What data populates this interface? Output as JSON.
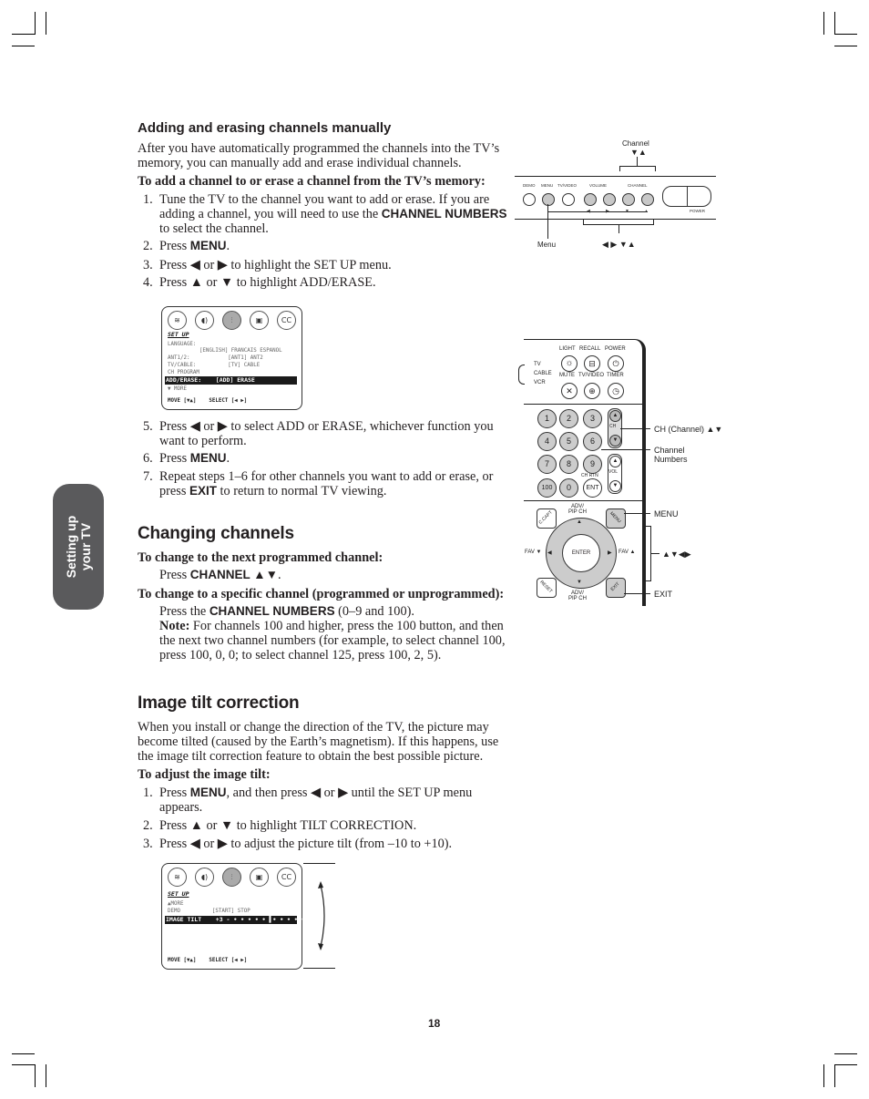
{
  "page": {
    "number": "18"
  },
  "side_tab": {
    "line1": "Setting up",
    "line2": "your TV"
  },
  "section1": {
    "title": "Adding and erasing channels manually",
    "intro": "After you have automatically programmed the channels into the TV’s memory, you can manually add and erase individual channels.",
    "subhead": "To add a channel to or erase a channel from the TV’s memory:",
    "steps": [
      {
        "n": "1.",
        "pre": "Tune the TV to the channel you want to add or erase. If you are adding a channel, you will need to use the ",
        "kw": "CHANNEL NUMBERS",
        "post": " to select the channel."
      },
      {
        "n": "2.",
        "pre": "Press ",
        "kw": "MENU",
        "post": "."
      },
      {
        "n": "3.",
        "text": "Press ◀ or ▶ to highlight the SET UP menu."
      },
      {
        "n": "4.",
        "text": "Press ▲ or ▼ to highlight ADD/ERASE."
      },
      {
        "n": "5.",
        "text": "Press ◀ or ▶ to select ADD or ERASE, whichever function you want to perform."
      },
      {
        "n": "6.",
        "pre": "Press ",
        "kw": "MENU",
        "post": "."
      },
      {
        "n": "7.",
        "pre": "Repeat steps 1–6 for other channels you want to add or erase, or press ",
        "kw": "EXIT",
        "post": " to return to normal TV viewing."
      }
    ]
  },
  "osd1": {
    "icons": [
      "picture-icon",
      "audio-icon",
      "setup-icon",
      "video-camera-icon",
      "cc-icon"
    ],
    "icon_glyphs": [
      "≋",
      "◖)",
      "⫶",
      "▣",
      "CC"
    ],
    "title": "SET UP",
    "rows": [
      "LANGUAGE:",
      "          [ENGLISH] FRANCAIS ESPANOL",
      "ANT1/2:            [ANT1] ANT2",
      "TV/CABLE:          [TV] CABLE",
      "CH PROGRAM"
    ],
    "highlight": "ADD/ERASE:    [ADD] ERASE",
    "more": "▼ MORE",
    "footer": "MOVE [▼▲]    SELECT [◀ ▶]"
  },
  "section2": {
    "title": "Changing channels",
    "sub1": "To change to the next programmed channel:",
    "press1_pre": "Press ",
    "press1_kw": "CHANNEL ▲▼",
    "press1_post": ".",
    "sub2": "To change to a specific channel (programmed or unprogrammed):",
    "press2_pre": "Press the ",
    "press2_kw": "CHANNEL NUMBERS",
    "press2_post": " (0–9 and 100).",
    "note_label": "Note:",
    "note_text": " For channels 100 and higher, press the 100 button, and then the next two channel numbers (for example, to select channel 100, press 100, 0, 0; to select channel 125, press 100, 2, 5)."
  },
  "section3": {
    "title": "Image tilt correction",
    "intro": "When you install or change the direction of the TV, the picture may become tilted (caused by the Earth’s magnetism). If this happens, use the image tilt correction feature to obtain the best possible picture.",
    "subhead": "To adjust the image tilt:",
    "steps": [
      {
        "n": "1.",
        "pre": "Press ",
        "kw": "MENU",
        "post": ", and then press ◀ or ▶ until the SET UP menu appears."
      },
      {
        "n": "2.",
        "text": "Press ▲ or ▼ to highlight TILT CORRECTION."
      },
      {
        "n": "3.",
        "text": "Press ◀ or ▶ to adjust the picture tilt (from –10 to +10)."
      }
    ]
  },
  "osd2": {
    "title": "SET UP",
    "rows": [
      "▲MORE",
      "DEMO          [START] STOP"
    ],
    "highlight": "IMAGE TILT    +3 - • • • • • ▌• • • • • • +",
    "tilt_value": 3,
    "tilt_range": [
      -10,
      10
    ],
    "footer": "MOVE [▼▲]    SELECT [◀ ▶]"
  },
  "tv_panel": {
    "top_label": "Channel",
    "top_arrows": "▼▲",
    "buttons": [
      "DEMO",
      "MENU",
      "TV/VIDEO",
      "VOLUME",
      "CHANNEL"
    ],
    "power": "POWER",
    "arrow_row": [
      "◀",
      "▶",
      "▼",
      "▲"
    ],
    "callout_menu": "Menu",
    "callout_arrows": "◀ ▶ ▼▲"
  },
  "remote": {
    "mode_labels": [
      "TV",
      "CABLE",
      "VCR"
    ],
    "top_labels": [
      "LIGHT",
      "RECALL",
      "POWER"
    ],
    "second_labels": [
      "MUTE",
      "TV/VIDEO",
      "TIMER"
    ],
    "keys": [
      "1",
      "2",
      "3",
      "4",
      "5",
      "6",
      "7",
      "8",
      "9",
      "100",
      "0",
      "ENT"
    ],
    "ch_label": "CH",
    "vol_label": "VOL",
    "ch_rtn": "CH RTN",
    "adv_top": "ADV/\nPIP CH",
    "adv_bottom": "ADV/\nPIP CH",
    "enter": "ENTER",
    "fav_left": "FAV ▼",
    "fav_right": "FAV ▲",
    "c_capt": "C.CAPT",
    "menu_key": "MENU",
    "reset_key": "RESET",
    "exit_key": "EXIT",
    "callouts": {
      "ch": "CH (Channel) ▲▼",
      "numbers": "Channel\nNumbers",
      "menu": "MENU",
      "arrows": "▲▼◀▶",
      "exit": "EXIT"
    }
  }
}
